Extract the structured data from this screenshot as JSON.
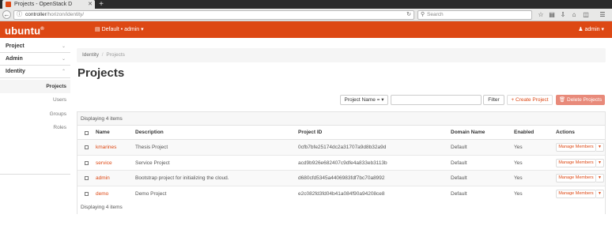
{
  "browser": {
    "tab_title": "Projects - OpenStack D",
    "tab_close": "✕",
    "new_tab": "+",
    "url_host": "controller",
    "url_path": "/horizon/identity/",
    "search_placeholder": "Search",
    "toolbar_icons": [
      "star-icon",
      "reading-list-icon",
      "download-icon",
      "home-icon",
      "pocket-icon",
      "menu-icon"
    ]
  },
  "header": {
    "logo": "ubuntu",
    "logo_mark": "®",
    "project_selector": "Default • admin ▾",
    "user_menu": "admin ▾"
  },
  "sidebar": {
    "sections": [
      {
        "label": "Project",
        "expanded": false
      },
      {
        "label": "Admin",
        "expanded": false
      },
      {
        "label": "Identity",
        "expanded": true
      }
    ],
    "items": [
      {
        "label": "Projects",
        "active": true
      },
      {
        "label": "Users",
        "active": false
      },
      {
        "label": "Groups",
        "active": false
      },
      {
        "label": "Roles",
        "active": false
      }
    ]
  },
  "breadcrumb": {
    "items": [
      "Identity",
      "Projects"
    ],
    "separator": "/"
  },
  "page_title": "Projects",
  "toolbar": {
    "filter_field": "Project Name = ▾",
    "filter_value": "",
    "filter_button": "Filter",
    "create_button": "+ Create Project",
    "delete_button": "Delete Projects"
  },
  "table": {
    "display_top": "Displaying 4 items",
    "display_bottom": "Displaying 4 items",
    "columns": [
      "Name",
      "Description",
      "Project ID",
      "Domain Name",
      "Enabled",
      "Actions"
    ],
    "rows": [
      {
        "name": "kmarines",
        "description": "Thesis Project",
        "project_id": "0cfb7bfe25174dc2a31707a9d8b32a9d",
        "domain": "Default",
        "enabled": "Yes",
        "action": "Manage Members"
      },
      {
        "name": "service",
        "description": "Service Project",
        "project_id": "acd9b926e682407c9dfe4a833eb3113b",
        "domain": "Default",
        "enabled": "Yes",
        "action": "Manage Members"
      },
      {
        "name": "admin",
        "description": "Bootstrap project for initializing the cloud.",
        "project_id": "d680cfd5345a4406983fdf7bc70a8992",
        "domain": "Default",
        "enabled": "Yes",
        "action": "Manage Members"
      },
      {
        "name": "demo",
        "description": "Demo Project",
        "project_id": "e2c082fd3fd04b41a084f90a94208ce8",
        "domain": "Default",
        "enabled": "Yes",
        "action": "Manage Members"
      }
    ]
  },
  "colors": {
    "brand": "#dd4814",
    "delete_button": "#e88a7a"
  }
}
